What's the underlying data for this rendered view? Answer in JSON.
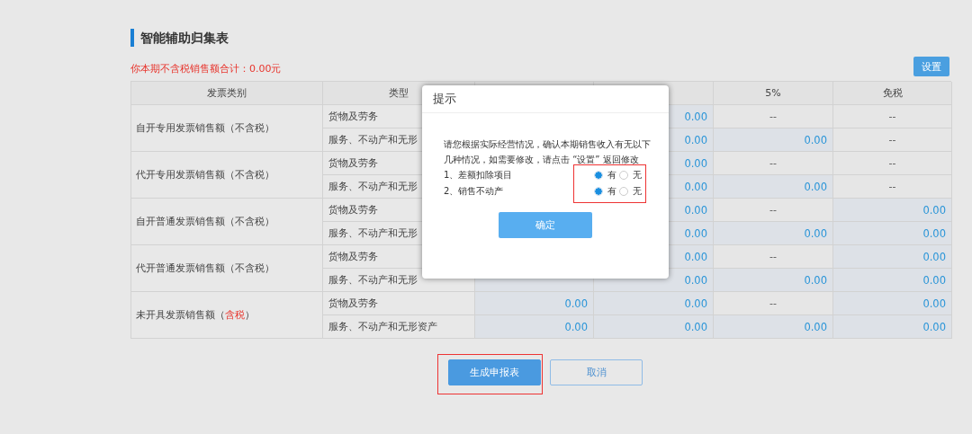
{
  "section_title": "智能辅助归集表",
  "total_notice": "你本期不含税销售额合计：0.00元",
  "settings_button": "设置",
  "table": {
    "header": {
      "category": "发票类别",
      "type": "类型",
      "rate_5": "5%",
      "exempt": "免税"
    },
    "groups": [
      {
        "category": [
          {
            "text": "自开专用发票销售额（不含税）",
            "highlight": false
          }
        ],
        "items": [
          {
            "type": "货物及劳务",
            "column_4": {
              "text": "0.00",
              "kind": "amount"
            },
            "rate_5": {
              "text": "--",
              "kind": "na"
            },
            "exempt": {
              "text": "--",
              "kind": "na"
            }
          },
          {
            "type": "服务、不动产和无形",
            "column_4": {
              "text": "0.00",
              "kind": "amount"
            },
            "rate_5": {
              "text": "0.00",
              "kind": "amount"
            },
            "exempt": {
              "text": "--",
              "kind": "na"
            }
          }
        ]
      },
      {
        "category": [
          {
            "text": "代开专用发票销售额（不含税）",
            "highlight": false
          }
        ],
        "items": [
          {
            "type": "货物及劳务",
            "column_4": {
              "text": "0.00",
              "kind": "amount"
            },
            "rate_5": {
              "text": "--",
              "kind": "na"
            },
            "exempt": {
              "text": "--",
              "kind": "na"
            }
          },
          {
            "type": "服务、不动产和无形",
            "column_4": {
              "text": "0.00",
              "kind": "amount"
            },
            "rate_5": {
              "text": "0.00",
              "kind": "amount"
            },
            "exempt": {
              "text": "--",
              "kind": "na"
            }
          }
        ]
      },
      {
        "category": [
          {
            "text": "自开普通发票销售额（不含税）",
            "highlight": false
          }
        ],
        "items": [
          {
            "type": "货物及劳务",
            "column_4": {
              "text": "0.00",
              "kind": "amount"
            },
            "rate_5": {
              "text": "--",
              "kind": "na"
            },
            "exempt": {
              "text": "0.00",
              "kind": "amount"
            }
          },
          {
            "type": "服务、不动产和无形",
            "column_4": {
              "text": "0.00",
              "kind": "amount"
            },
            "rate_5": {
              "text": "0.00",
              "kind": "amount"
            },
            "exempt": {
              "text": "0.00",
              "kind": "amount"
            }
          }
        ]
      },
      {
        "category": [
          {
            "text": "代开普通发票销售额（不含税）",
            "highlight": false
          }
        ],
        "items": [
          {
            "type": "货物及劳务",
            "column_4": {
              "text": "0.00",
              "kind": "amount"
            },
            "rate_5": {
              "text": "--",
              "kind": "na"
            },
            "exempt": {
              "text": "0.00",
              "kind": "amount"
            }
          },
          {
            "type": "服务、不动产和无形",
            "column_4": {
              "text": "0.00",
              "kind": "amount"
            },
            "rate_5": {
              "text": "0.00",
              "kind": "amount"
            },
            "exempt": {
              "text": "0.00",
              "kind": "amount"
            }
          }
        ]
      },
      {
        "category": [
          {
            "text": "未开具发票销售额（",
            "highlight": false
          },
          {
            "text": "含税",
            "highlight": true
          },
          {
            "text": "）",
            "highlight": false
          }
        ],
        "items": [
          {
            "type": "货物及劳务",
            "column_3": {
              "text": "0.00",
              "kind": "amount"
            },
            "column_4": {
              "text": "0.00",
              "kind": "amount"
            },
            "rate_5": {
              "text": "--",
              "kind": "na"
            },
            "exempt": {
              "text": "0.00",
              "kind": "amount"
            }
          },
          {
            "type": "服务、不动产和无形资产",
            "column_3": {
              "text": "0.00",
              "kind": "amount"
            },
            "column_4": {
              "text": "0.00",
              "kind": "amount"
            },
            "rate_5": {
              "text": "0.00",
              "kind": "amount"
            },
            "exempt": {
              "text": "0.00",
              "kind": "amount"
            }
          }
        ]
      }
    ]
  },
  "dialog": {
    "title": "提示",
    "message": "请您根据实际经营情况，确认本期销售收入有无以下几种情况，如需要修改，请点击 “设置” 返回修改",
    "choices_highlighted": true,
    "options": [
      {
        "label": "1、差额扣除项目",
        "choices": [
          {
            "label": "有",
            "selected": true
          },
          {
            "label": "无",
            "selected": false
          }
        ]
      },
      {
        "label": "2、销售不动产",
        "choices": [
          {
            "label": "有",
            "selected": true
          },
          {
            "label": "无",
            "selected": false
          }
        ]
      }
    ],
    "confirm_button": "确定"
  },
  "actions": [
    {
      "label": "生成申报表",
      "kind": "primary",
      "highlighted": true
    },
    {
      "label": "取消",
      "kind": "secondary"
    }
  ]
}
